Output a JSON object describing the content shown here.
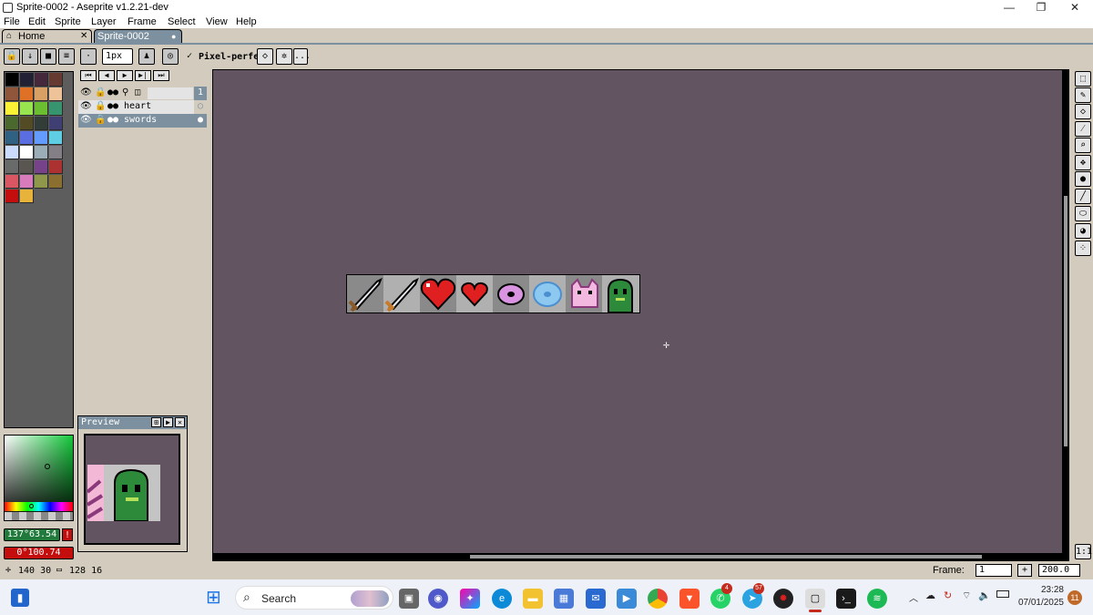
{
  "window": {
    "title": "Sprite-0002 - Aseprite v1.2.21-dev",
    "minimize": "—",
    "maximize": "❐",
    "close": "✕"
  },
  "menu": [
    "File",
    "Edit",
    "Sprite",
    "Layer",
    "Frame",
    "Select",
    "View",
    "Help"
  ],
  "tabs": [
    {
      "label": "Home",
      "close": "✕"
    },
    {
      "label": "Sprite-0002",
      "close": "●"
    }
  ],
  "toolbar": {
    "brush_size": "1px",
    "pixel_perfect_label": "Pixel-perfect",
    "more": "..."
  },
  "timeline": {
    "frame_number": "1",
    "layers": [
      {
        "name": "heart"
      },
      {
        "name": "swords"
      }
    ]
  },
  "preview": {
    "title": "Preview"
  },
  "color": {
    "foreground_label": "137°63.54",
    "background_label": "0°100.74",
    "warning": "!",
    "foreground": "#1f7a3c",
    "background": "#c40d0d"
  },
  "status": {
    "position": "140 30",
    "size": "128 16",
    "frame_label": "Frame:",
    "frame_value": "1",
    "zoom": "200.0",
    "add": "+",
    "one_to_one": "1:1"
  },
  "taskbar": {
    "search": "Search",
    "time": "23:28",
    "date": "07/01/2025",
    "notifications": "11",
    "whatsapp_badge": "4",
    "telegram_badge": "57"
  },
  "palette_colors": [
    "#000000",
    "#222034",
    "#45283c",
    "#663931",
    "#8f563b",
    "#df7126",
    "#d9a066",
    "#eec39a",
    "#fbf236",
    "#99e550",
    "#6abe30",
    "#37946e",
    "#4b692f",
    "#524b24",
    "#323c39",
    "#3f3f74",
    "#306082",
    "#5b6ee1",
    "#639bff",
    "#5fcde4",
    "#cbdbfc",
    "#ffffff",
    "#9badb7",
    "#847e87",
    "#696a6a",
    "#595652",
    "#76428a",
    "#ac3232",
    "#d95763",
    "#d77bba",
    "#8f974a",
    "#8a6f30",
    "#c40d0d",
    "#e8b33a"
  ]
}
